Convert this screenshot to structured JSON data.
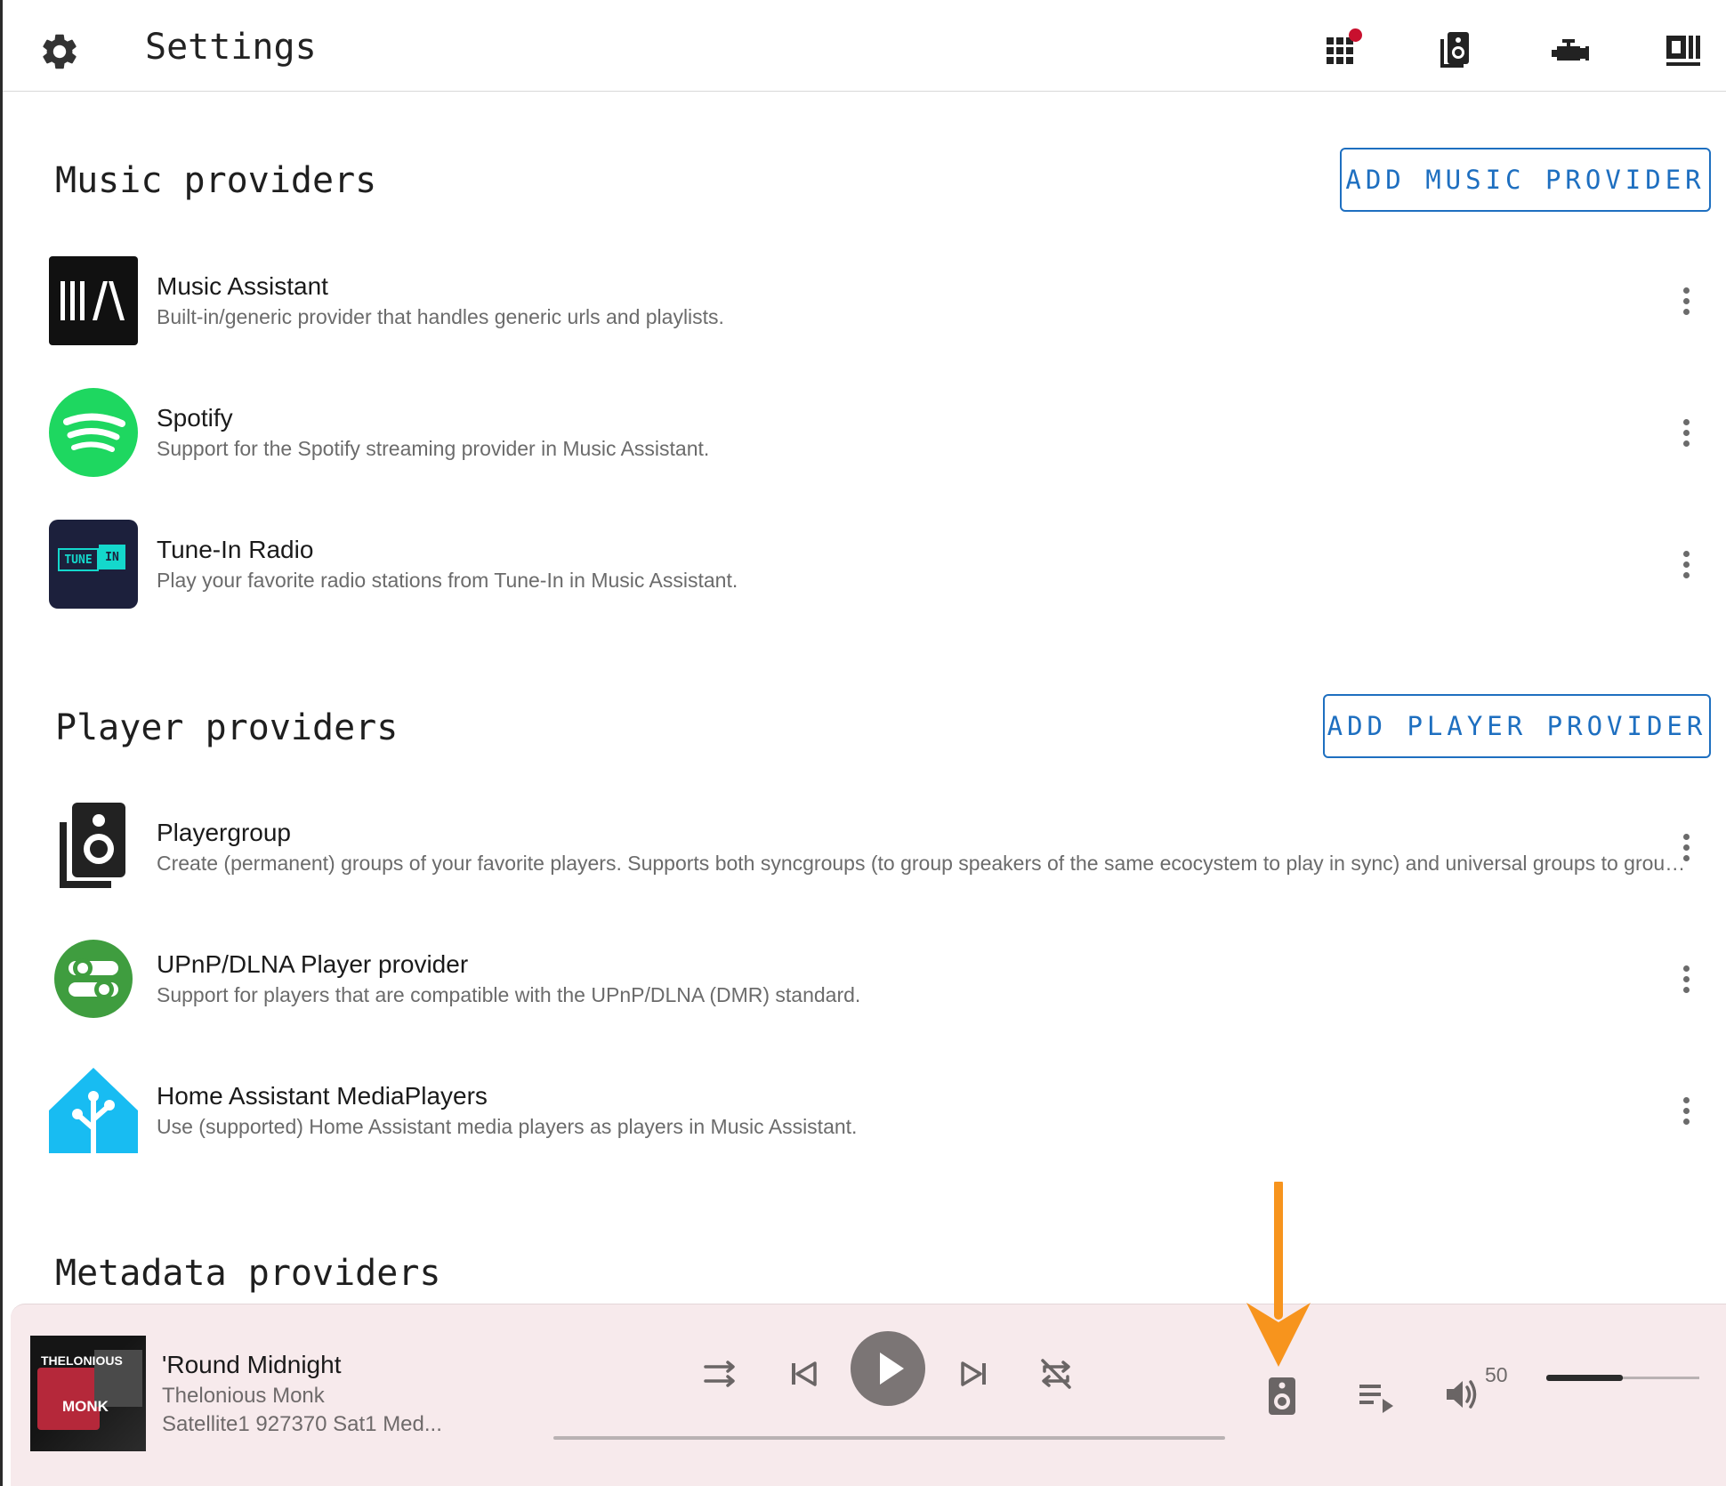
{
  "header": {
    "title": "Settings",
    "icons": [
      "gear-icon",
      "grid-icon",
      "speaker-icon",
      "engine-icon",
      "ui-icon"
    ],
    "notification_color": "#c8102e"
  },
  "sections": {
    "music": {
      "heading": "Music providers",
      "add_label": "ADD MUSIC PROVIDER",
      "items": [
        {
          "name": "Music Assistant",
          "description": "Built-in/generic provider that handles generic urls and playlists.",
          "logo_text": "III/\\"
        },
        {
          "name": "Spotify",
          "description": "Support for the Spotify streaming provider in Music Assistant."
        },
        {
          "name": "Tune-In Radio",
          "description": "Play your favorite radio stations from Tune-In in Music Assistant.",
          "logo_text_1": "TUNE",
          "logo_text_2": "IN"
        }
      ]
    },
    "player": {
      "heading": "Player providers",
      "add_label": "ADD PLAYER PROVIDER",
      "items": [
        {
          "name": "Playergroup",
          "description": "Create (permanent) groups of your favorite players. Supports both syncgroups (to group speakers of the same ecocystem to play in sync) and universal groups to group speakers of different ecosystems to play in sync"
        },
        {
          "name": "UPnP/DLNA Player provider",
          "description": "Support for players that are compatible with the UPnP/DLNA (DMR) standard."
        },
        {
          "name": "Home Assistant MediaPlayers",
          "description": "Use (supported) Home Assistant media players as players in Music Assistant."
        }
      ]
    },
    "metadata": {
      "heading": "Metadata providers"
    }
  },
  "player_bar": {
    "track_title": "'Round Midnight",
    "artist": "Thelonious Monk",
    "player_name": "Satellite1 927370 Sat1 Med...",
    "album_text_1": "THELONIOUS",
    "album_text_2": "MONK",
    "volume": "50",
    "volume_level": 0.5,
    "progress": 0.0
  },
  "colors": {
    "accent": "#1e6fc0",
    "spotify": "#1ed760",
    "tunein_bg": "#1c203c",
    "tunein_accent": "#14d8cc",
    "upnp": "#3f9d3f",
    "home_assistant": "#18bcf2",
    "player_bg": "#f7eaec",
    "arrow": "#f7941d"
  }
}
